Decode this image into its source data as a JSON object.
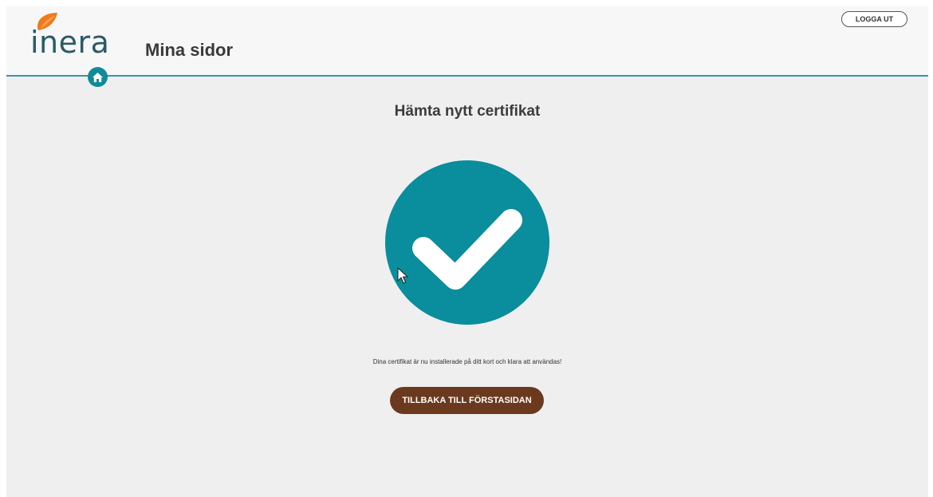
{
  "header": {
    "logo_text": "inera",
    "site_title": "Mina sidor",
    "logout_label": "LOGGA UT",
    "home_icon": "home-icon"
  },
  "main": {
    "title": "Hämta nytt certifikat",
    "status_icon": "checkmark-icon",
    "message": "Dina certifikat är nu installerade på ditt kort och klara att användas!",
    "back_label": "TILLBAKA TILL FÖRSTASIDAN"
  },
  "colors": {
    "accent_teal": "#0a8d9c",
    "button_brown": "#6b3a1e",
    "logo_orange": "#f07a1a",
    "header_line": "#3a97a0"
  }
}
